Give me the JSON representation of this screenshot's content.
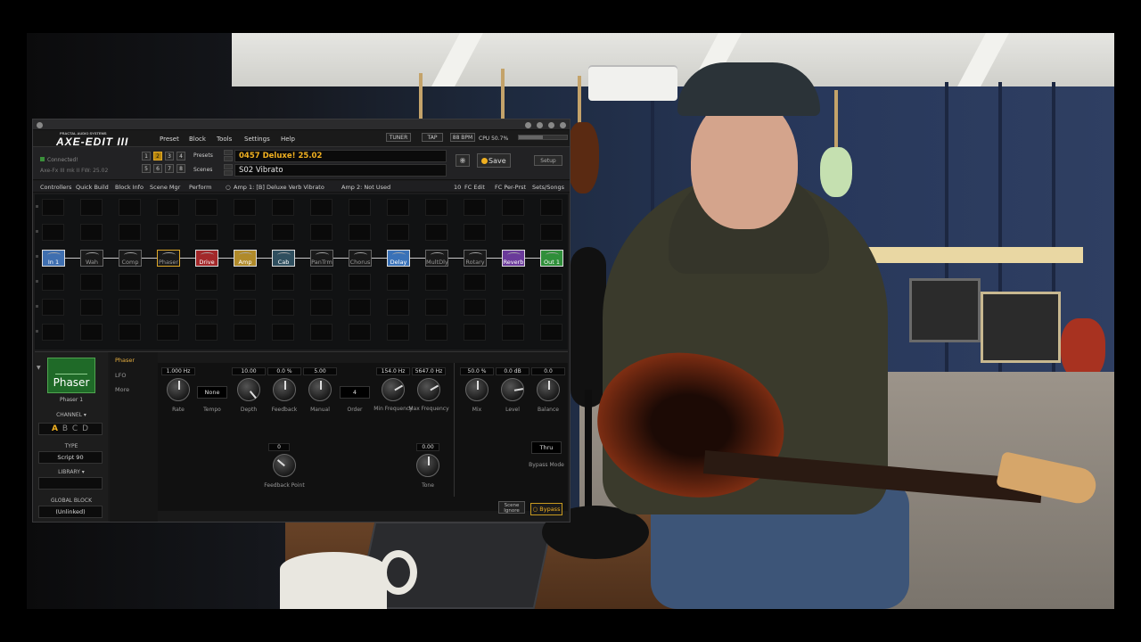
{
  "app": {
    "logo_small": "FRACTAL AUDIO SYSTEMS",
    "logo_main": "AXE-EDIT III",
    "menu": [
      "Preset",
      "Block",
      "Tools",
      "Settings",
      "Help"
    ],
    "tuner_label": "TUNER",
    "tap_label": "TAP",
    "bpm": "88 BPM",
    "cpu_label": "CPU 50.7%",
    "cpu_percent": 50.7
  },
  "header": {
    "status": "Connected!",
    "firmware": "Axe-Fx III mk II FW: 25.02",
    "numbers": [
      "1",
      "2",
      "3",
      "4",
      "5",
      "6",
      "7",
      "8"
    ],
    "active_number": "2",
    "presets_label": "Presets",
    "scenes_label": "Scenes",
    "preset": "0457  Deluxe! 25.02",
    "scene": "S02  Vibrato",
    "save_label": "Save",
    "setup_label": "Setup",
    "camera_icon": "camera-icon"
  },
  "tabs": {
    "left": [
      "Controllers",
      "Quick Build",
      "Block Info",
      "Scene Mgr",
      "Perform"
    ],
    "info_1": "Amp 1: [B] Deluxe Verb Vibrato",
    "info_2": "Amp 2: Not Used",
    "right": [
      "10",
      "FC Edit",
      "FC Per-Prst",
      "Sets/Songs"
    ]
  },
  "grid": {
    "blocks": [
      {
        "label": "In 1",
        "color": "#3f6fb0",
        "on": true
      },
      {
        "label": "Wah",
        "color": "#1a1a1a",
        "on": false
      },
      {
        "label": "Comp",
        "color": "#1a1a1a",
        "on": false
      },
      {
        "label": "Phaser",
        "color": "#1a1a1a",
        "on": false,
        "selected": true
      },
      {
        "label": "Drive",
        "color": "#a3282a",
        "on": true
      },
      {
        "label": "Amp",
        "color": "#b08a2a",
        "on": true
      },
      {
        "label": "Cab",
        "color": "#2f4f5f",
        "on": true
      },
      {
        "label": "PanTrm",
        "color": "#1a1a1a",
        "on": false
      },
      {
        "label": "Chorus",
        "color": "#1a1a1a",
        "on": false
      },
      {
        "label": "Delay",
        "color": "#3a72b8",
        "on": true
      },
      {
        "label": "MultDly",
        "color": "#1a1a1a",
        "on": false
      },
      {
        "label": "Rotary",
        "color": "#1a1a1a",
        "on": false
      },
      {
        "label": "Reverb",
        "color": "#6a3a9a",
        "on": true
      },
      {
        "label": "Out 1",
        "color": "#2f8f3a",
        "on": true
      }
    ]
  },
  "block_panel": {
    "title": "Phaser",
    "instance": "Phaser 1",
    "channel_label": "CHANNEL",
    "channels": [
      "A",
      "B",
      "C",
      "D"
    ],
    "active_channel": "A",
    "type_label": "TYPE",
    "type_value": "Script 90",
    "library_label": "LIBRARY",
    "library_value": "",
    "global_label": "GLOBAL BLOCK",
    "global_value": "(Unlinked)"
  },
  "pages": [
    "Phaser",
    "LFO",
    "More"
  ],
  "params": {
    "rate": {
      "value": "1.000 Hz",
      "name": "Rate"
    },
    "tempo": {
      "value": "None",
      "name": "Tempo"
    },
    "depth": {
      "value": "10.00",
      "name": "Depth"
    },
    "feedback": {
      "value": "0.0 %",
      "name": "Feedback"
    },
    "manual": {
      "value": "5.00",
      "name": "Manual"
    },
    "order": {
      "value": "4",
      "name": "Order"
    },
    "minfreq": {
      "value": "154.0 Hz",
      "name": "Min Frequency"
    },
    "maxfreq": {
      "value": "5647.0 Hz",
      "name": "Max Frequency"
    },
    "mix": {
      "value": "50.0 %",
      "name": "Mix"
    },
    "level": {
      "value": "0.0 dB",
      "name": "Level"
    },
    "balance": {
      "value": "0.0",
      "name": "Balance"
    },
    "fbpoint": {
      "value": "0",
      "name": "Feedback Point"
    },
    "tone": {
      "value": "0.00",
      "name": "Tone"
    },
    "bypassmode": {
      "value": "Thru",
      "name": "Bypass Mode"
    }
  },
  "footer": {
    "scene_ignore": "Scene Ignore",
    "bypass": "Bypass"
  }
}
